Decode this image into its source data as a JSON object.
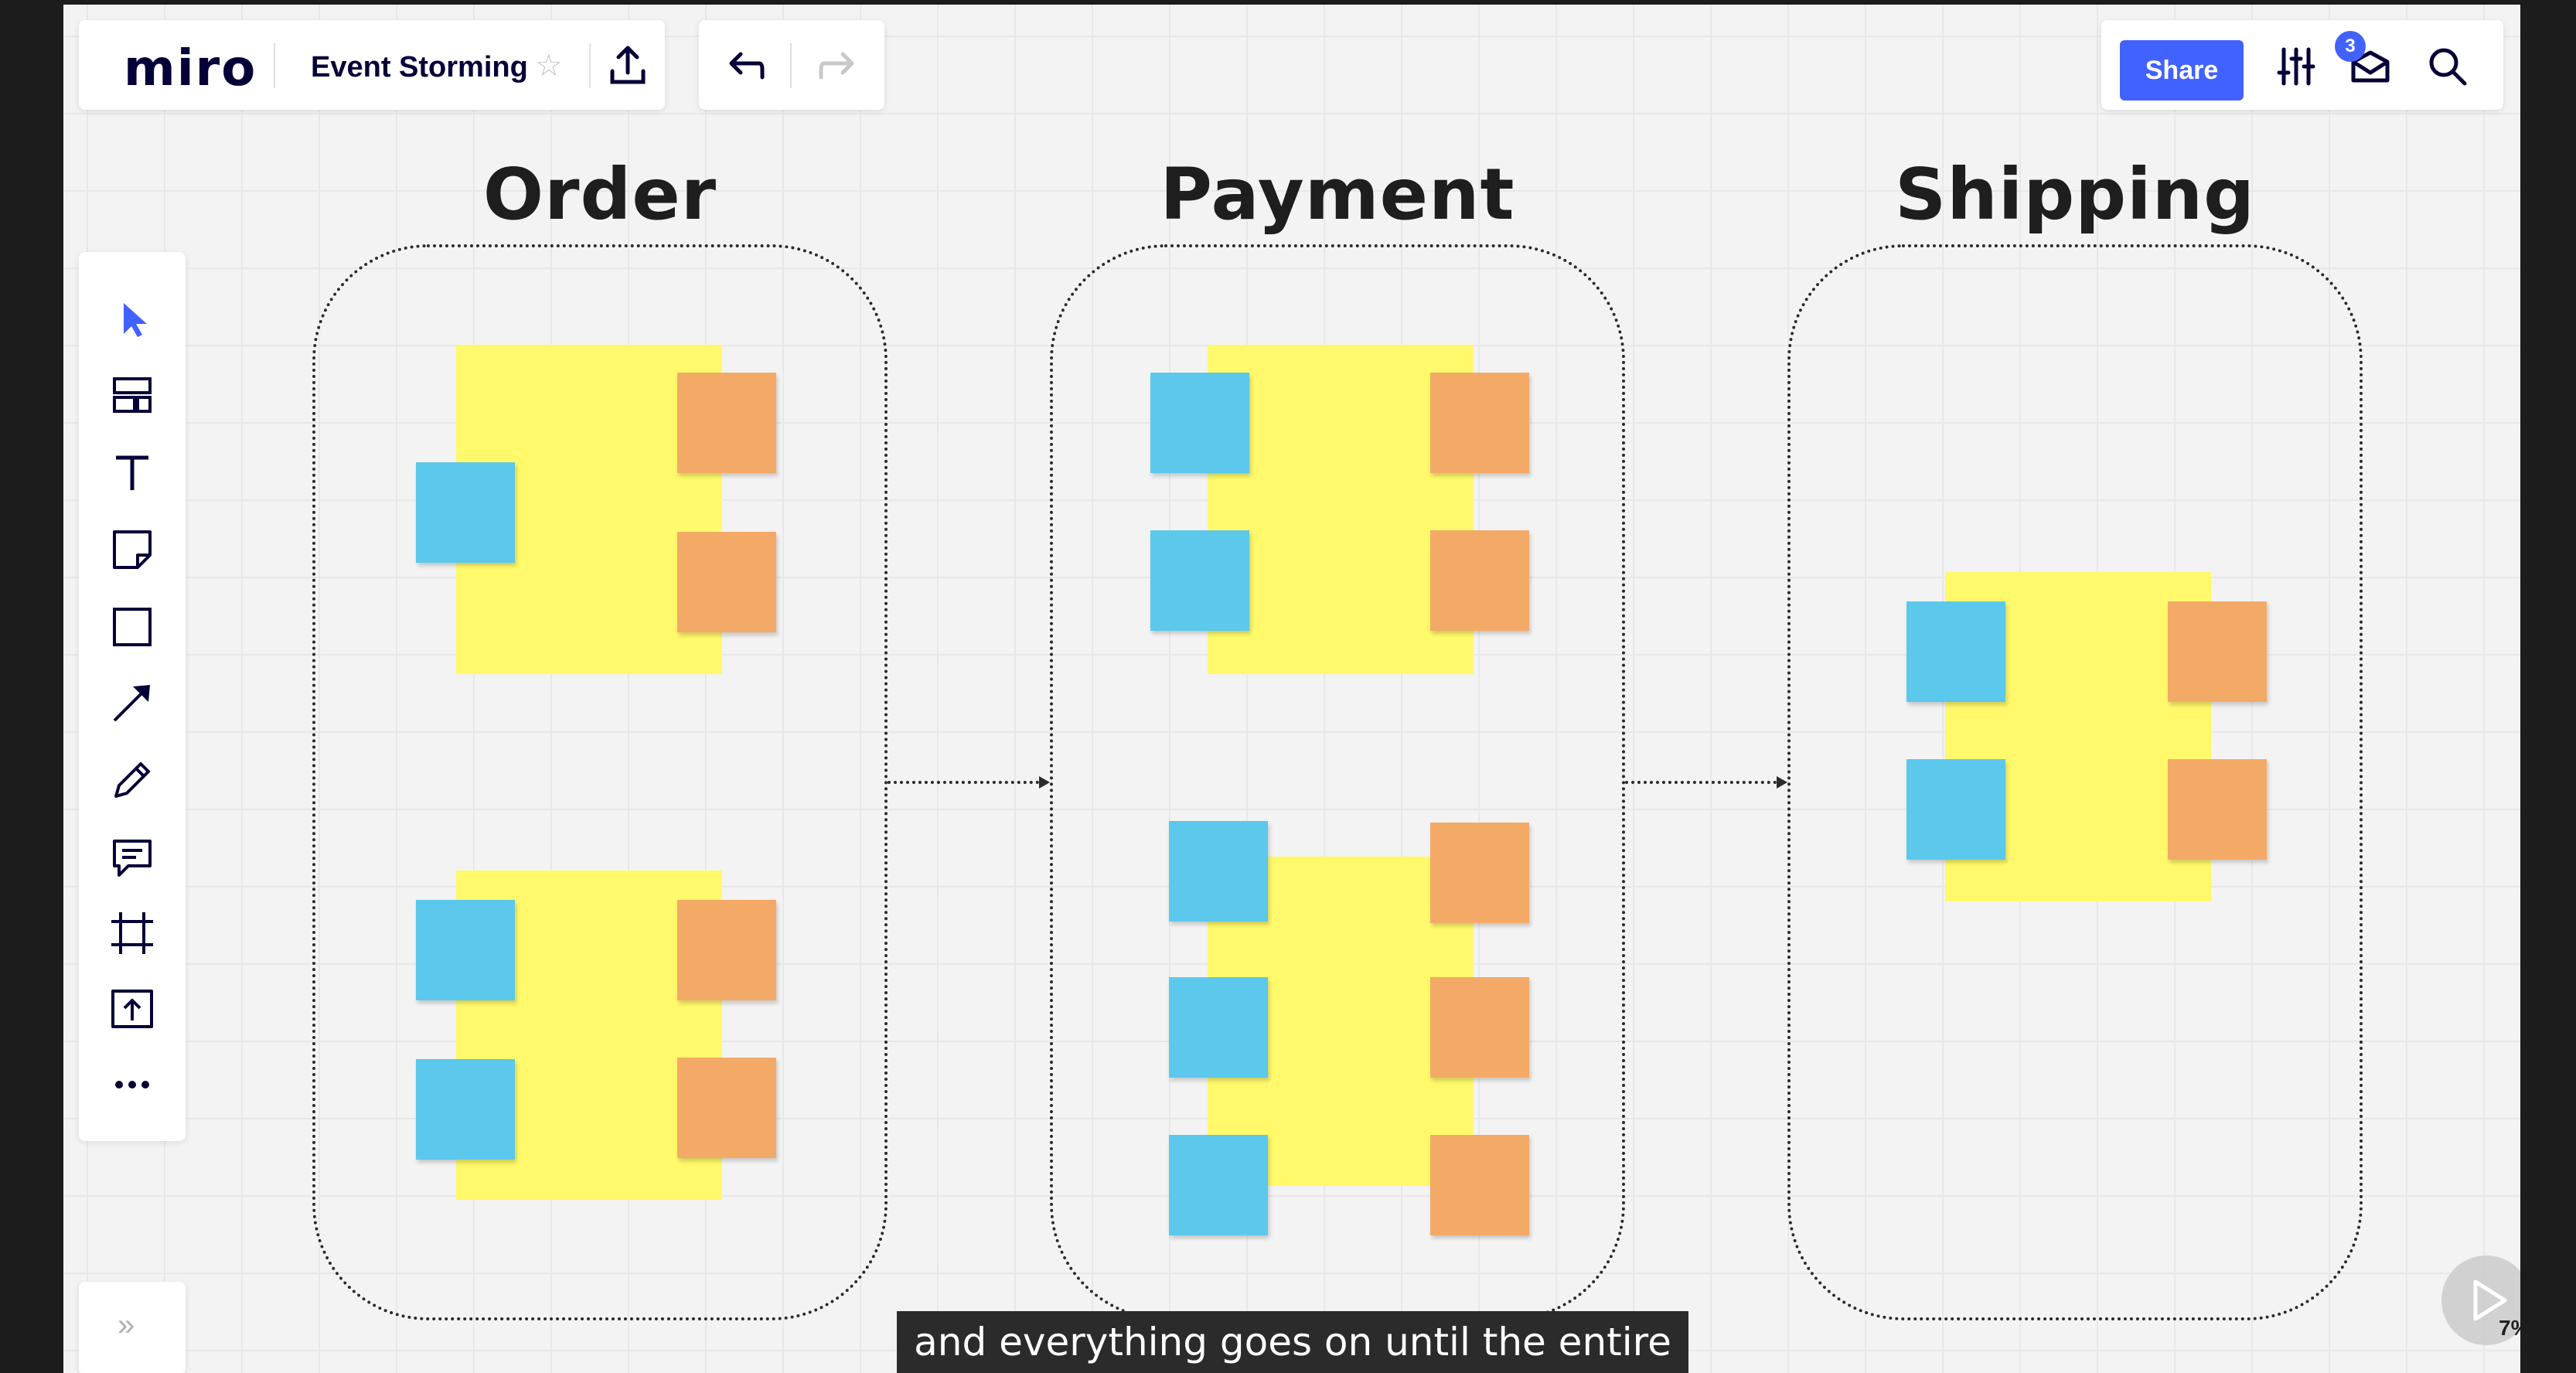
{
  "app": {
    "logo": "miro",
    "board_name": "Event Storming"
  },
  "header": {
    "star_icon": "star-icon",
    "upload_icon": "upload-icon",
    "undo_icon": "undo-icon",
    "redo_icon": "redo-icon",
    "share_label": "Share",
    "settings_icon": "sliders-icon",
    "notifications_badge": "3",
    "search_icon": "search-icon"
  },
  "toolbar": {
    "tools": [
      "select-icon",
      "templates-icon",
      "text-icon",
      "sticky-note-icon",
      "shape-icon",
      "arrow-icon",
      "pen-icon",
      "comment-icon",
      "frame-icon",
      "upload-icon",
      "more-icon"
    ],
    "expand_label": "»"
  },
  "frames": [
    {
      "title": "Order"
    },
    {
      "title": "Payment"
    },
    {
      "title": "Shipping"
    }
  ],
  "colors": {
    "accent": "#4262ff",
    "sticky_yellow": "#fff96b",
    "sticky_blue": "#5bc8ec",
    "sticky_orange": "#f3aa66"
  },
  "caption": {
    "text": "and everything goes on until the entire"
  },
  "player": {
    "progress": "7%"
  }
}
